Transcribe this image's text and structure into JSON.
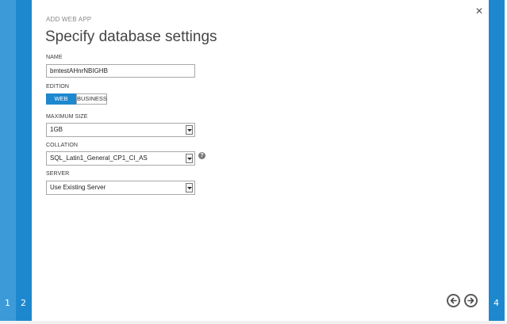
{
  "wizard": {
    "breadcrumb": "ADD WEB APP",
    "title": "Specify database settings",
    "steps": {
      "left": [
        "1",
        "2"
      ],
      "right": "4"
    },
    "close_icon": "close-icon"
  },
  "form": {
    "name": {
      "label": "NAME",
      "value": "bmtestAHnrNBIGHB"
    },
    "edition": {
      "label": "EDITION",
      "options": [
        "WEB",
        "BUSINESS"
      ],
      "selected": "WEB"
    },
    "maximum_size": {
      "label": "MAXIMUM SIZE",
      "value": "1GB"
    },
    "collation": {
      "label": "COLLATION",
      "value": "SQL_Latin1_General_CP1_CI_AS",
      "help_icon": "question-icon"
    },
    "server": {
      "label": "SERVER",
      "value": "Use Existing Server"
    }
  },
  "navigation": {
    "back_icon": "arrow-left-icon",
    "next_icon": "arrow-right-icon"
  },
  "colors": {
    "accent": "#1e88ce",
    "accent_light": "#3d9ad8"
  }
}
